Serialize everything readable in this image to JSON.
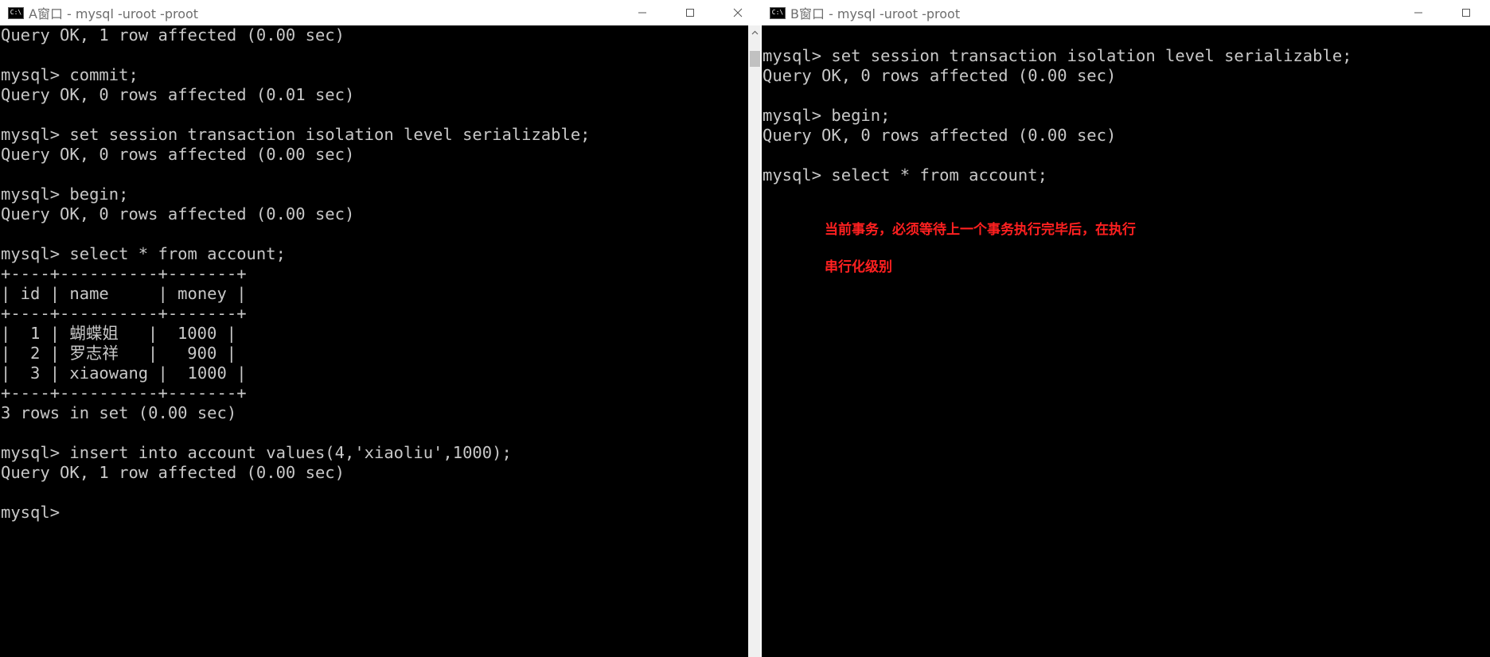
{
  "window_a": {
    "title": "A窗口 - mysql  -uroot -proot",
    "icon": "console-icon",
    "controls": [
      "minimize-icon",
      "maximize-icon",
      "close-icon"
    ],
    "console_text": "Query OK, 1 row affected (0.00 sec)\n\nmysql> commit;\nQuery OK, 0 rows affected (0.01 sec)\n\nmysql> set session transaction isolation level serializable;\nQuery OK, 0 rows affected (0.00 sec)\n\nmysql> begin;\nQuery OK, 0 rows affected (0.00 sec)\n\nmysql> select * from account;\n+----+----------+-------+\n| id | name     | money |\n+----+----------+-------+\n|  1 | 蝴蝶姐   |  1000 |\n|  2 | 罗志祥   |   900 |\n|  3 | xiaowang |  1000 |\n+----+----------+-------+\n3 rows in set (0.00 sec)\n\nmysql> insert into account values(4,'xiaoliu',1000);\nQuery OK, 1 row affected (0.00 sec)\n\nmysql>"
  },
  "window_b": {
    "title": "B窗口 - mysql  -uroot -proot",
    "icon": "console-icon",
    "controls": [
      "minimize-icon",
      "maximize-icon"
    ],
    "console_text": "mysql> set session transaction isolation level serializable;\nQuery OK, 0 rows affected (0.00 sec)\n\nmysql> begin;\nQuery OK, 0 rows affected (0.00 sec)\n\nmysql> select * from account;"
  },
  "annotations": [
    "当前事务，必须等待上一个事务执行完毕后，在执行",
    "串行化级别"
  ],
  "colors": {
    "console_bg": "#000000",
    "console_text": "#c8c8c8",
    "annotation": "#ff2020",
    "titlebar_bg": "#ffffff"
  }
}
